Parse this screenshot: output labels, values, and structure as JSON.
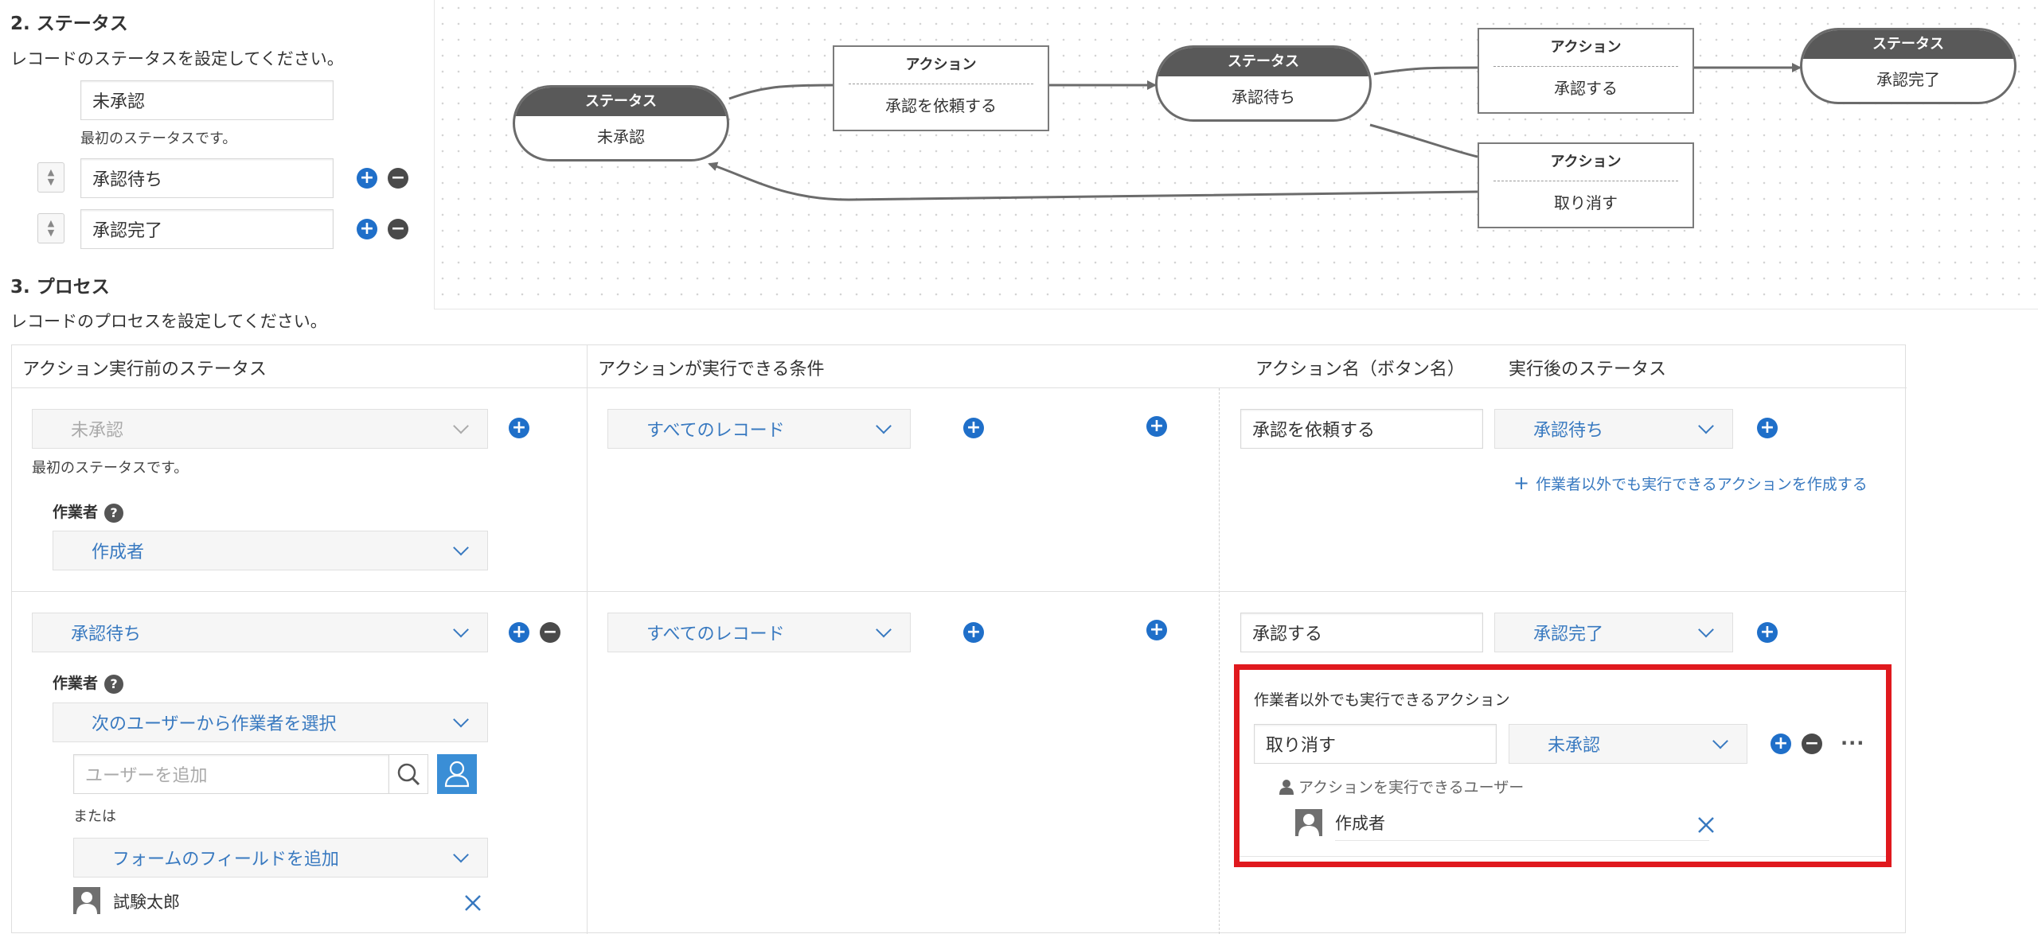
{
  "status_section": {
    "title": "2. ステータス",
    "description": "レコードのステータスを設定してください。",
    "statuses": [
      "未承認",
      "承認待ち",
      "承認完了"
    ],
    "first_status_note": "最初のステータスです。"
  },
  "process_section": {
    "title": "3. プロセス",
    "description": "レコードのプロセスを設定してください。"
  },
  "flow": {
    "status_header": "ステータス",
    "action_header": "アクション",
    "statuses": [
      "未承認",
      "承認待ち",
      "承認完了"
    ],
    "actions": [
      "承認を依頼する",
      "承認する",
      "取り消す"
    ]
  },
  "table": {
    "headers": [
      "アクション実行前のステータス",
      "アクションが実行できる条件",
      "アクション名（ボタン名）",
      "実行後のステータス"
    ],
    "row1": {
      "status": "未承認",
      "first_note": "最初のステータスです。",
      "assignee_label": "作業者",
      "assignee_value": "作成者",
      "condition": "すべてのレコード",
      "action_name": "承認を依頼する",
      "next_status": "承認待ち",
      "add_other_action": "作業者以外でも実行できるアクションを作成する"
    },
    "row2": {
      "status": "承認待ち",
      "assignee_label": "作業者",
      "assignee_value": "次のユーザーから作業者を選択",
      "user_search_placeholder": "ユーザーを追加",
      "or_label": "または",
      "field_select": "フォームのフィールドを追加",
      "user_name": "試験太郎",
      "condition": "すべてのレコード",
      "action_name": "承認する",
      "next_status": "承認完了"
    },
    "other_action_panel": {
      "title": "作業者以外でも実行できるアクション",
      "action_name": "取り消す",
      "next_status": "未承認",
      "users_label": "アクションを実行できるユーザー",
      "user_name": "作成者"
    }
  },
  "colors": {
    "accent": "#1f6fc9",
    "highlight": "#e0191e"
  }
}
